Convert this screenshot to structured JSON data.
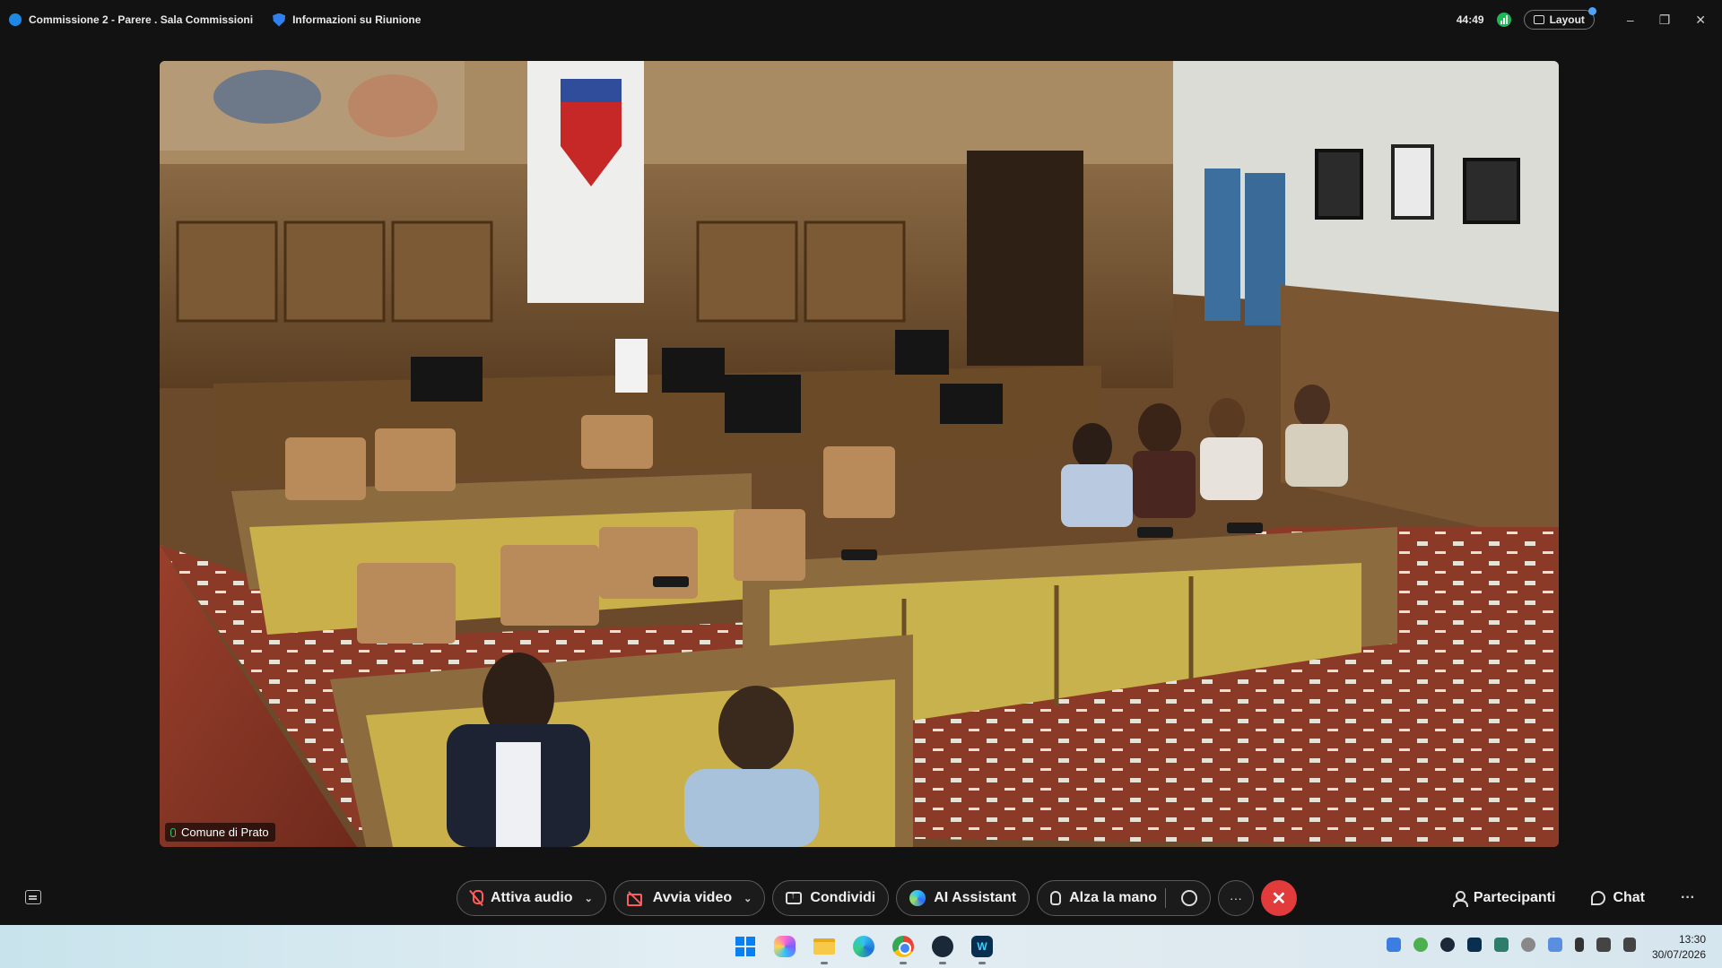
{
  "window": {
    "meeting_title": "Commissione 2 - Parere . Sala Commissioni",
    "meeting_info": "Informazioni su Riunione",
    "timer": "44:49",
    "layout_label": "Layout",
    "minimize": "–",
    "restore": "❐",
    "close": "✕"
  },
  "video": {
    "participant_name": "Comune di Prato"
  },
  "controls": {
    "audio_label": "Attiva audio",
    "video_label": "Avvia video",
    "share_label": "Condividi",
    "ai_label": "AI Assistant",
    "hand_label": "Alza la mano",
    "more_label": "···",
    "end_label": "✕",
    "participants_label": "Partecipanti",
    "chat_label": "Chat",
    "overflow_label": "···",
    "caret": "⌄"
  },
  "taskbar": {
    "time": "13:30",
    "date": "30/07/2026"
  },
  "colors": {
    "end_call": "#e23b3b",
    "muted_icon": "#ff5b5b",
    "accent": "#4fa3ff"
  }
}
